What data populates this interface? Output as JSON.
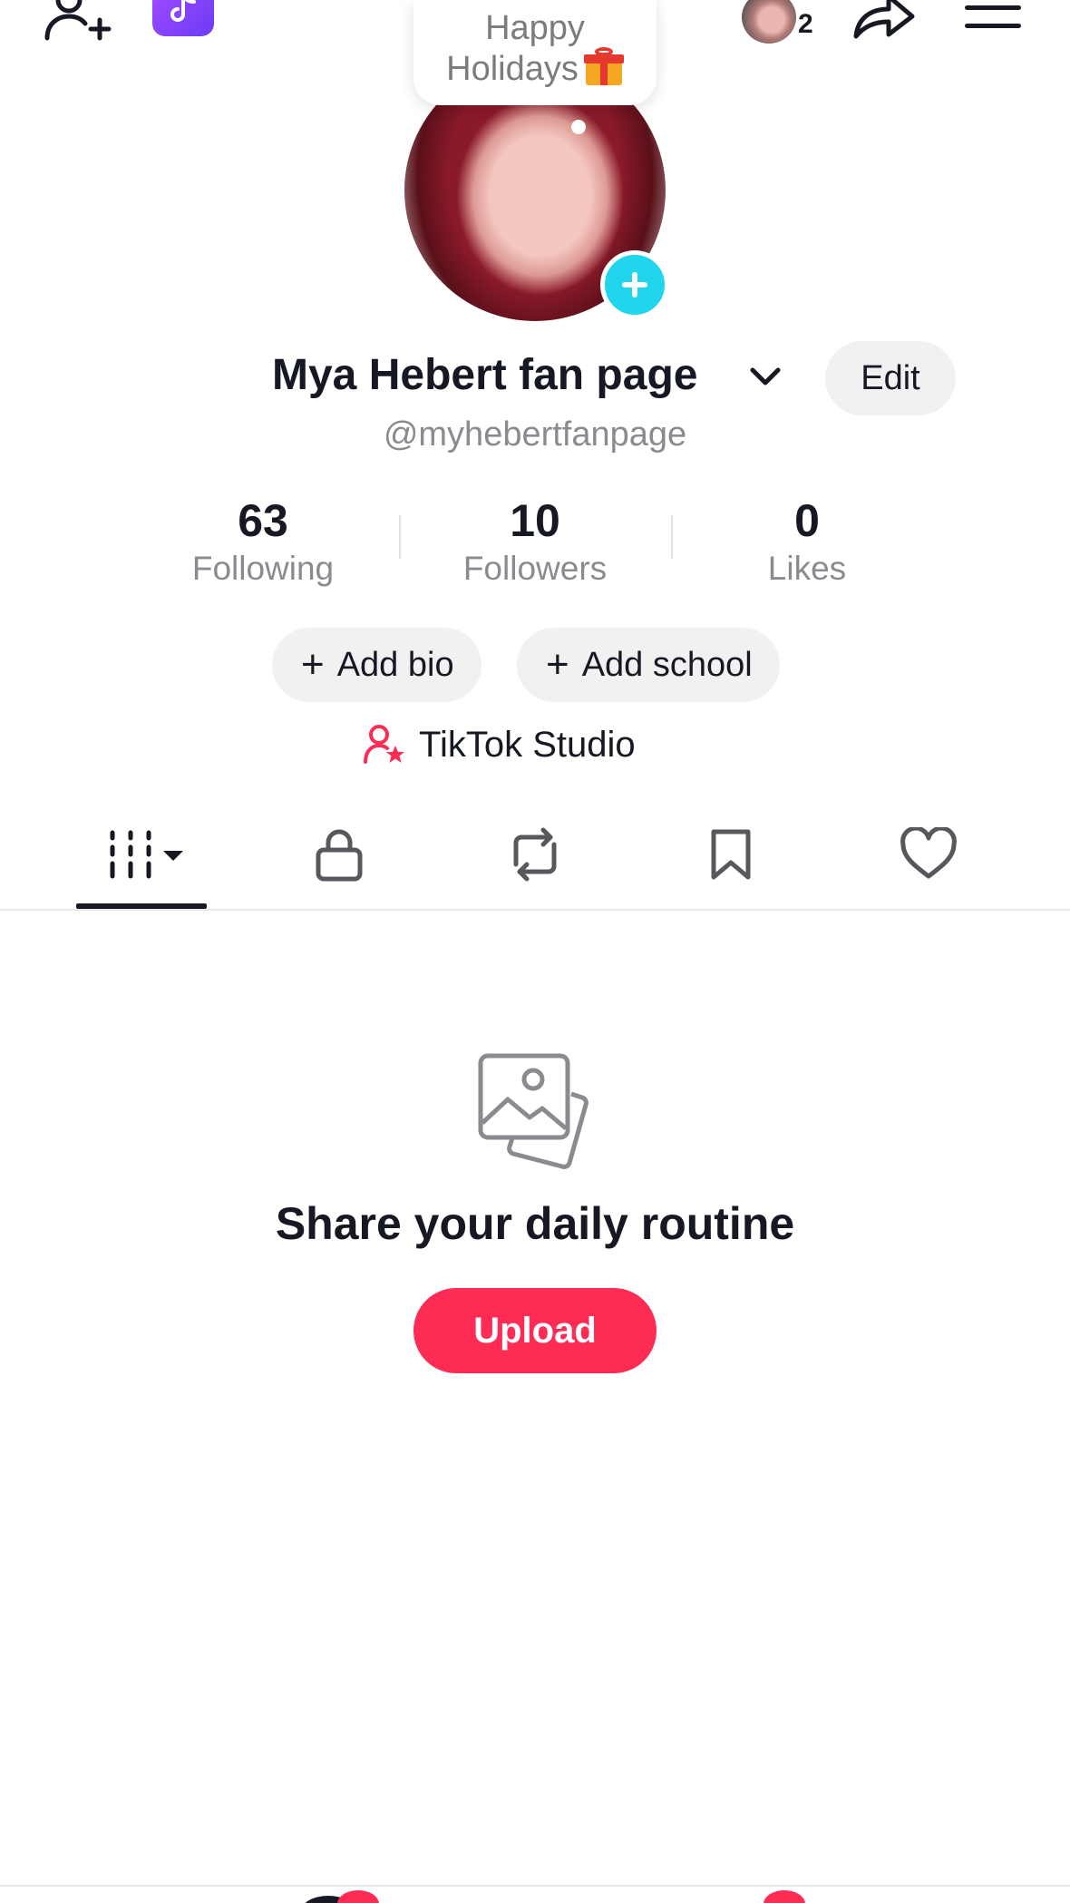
{
  "top_bar": {
    "icons": [
      "add-friend-icon",
      "tiktok-app-icon",
      "share-icon",
      "menu-icon"
    ],
    "stories_count": "2"
  },
  "holiday_bubble": {
    "line1": "Happy",
    "line2": "Holidays"
  },
  "profile": {
    "display_name": "Mya Hebert fan page",
    "username": "@myhebertfanpage",
    "edit_label": "Edit"
  },
  "stats": [
    {
      "value": "63",
      "label": "Following"
    },
    {
      "value": "10",
      "label": "Followers"
    },
    {
      "value": "0",
      "label": "Likes"
    }
  ],
  "actions": {
    "add_bio": "Add bio",
    "add_school": "Add school",
    "studio": "TikTok Studio"
  },
  "tabs": [
    "videos-grid-icon",
    "lock-icon",
    "repost-icon",
    "bookmark-icon",
    "heart-icon"
  ],
  "empty_state": {
    "title": "Share your daily routine",
    "upload_label": "Upload"
  },
  "colors": {
    "accent": "#fe2c55",
    "cyan": "#20d5ec",
    "text": "#161823",
    "muted": "#8a8b91"
  }
}
